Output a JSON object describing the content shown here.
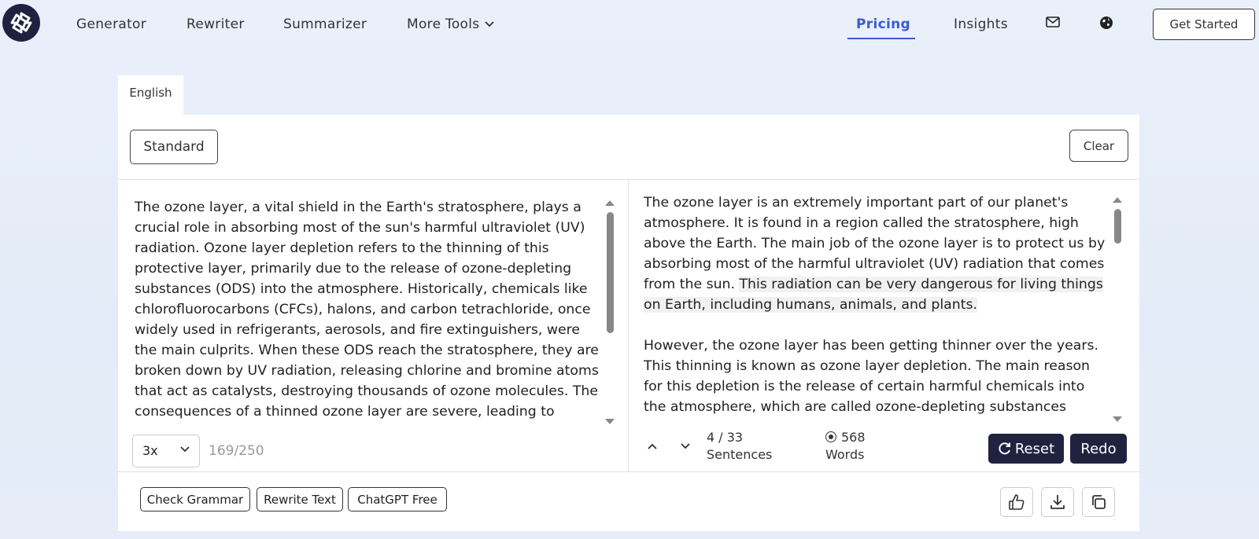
{
  "nav": {
    "links": [
      {
        "label": "Generator"
      },
      {
        "label": "Rewriter"
      },
      {
        "label": "Summarizer"
      },
      {
        "label": "More Tools"
      }
    ],
    "pricing": "Pricing",
    "insights": "Insights",
    "mail_icon": "mail-icon",
    "globe_icon": "globe-icon",
    "get_started": "Get Started",
    "accent_color": "#3b5bd6"
  },
  "editor": {
    "language_tab": "English",
    "mode": "Standard",
    "clear": "Clear",
    "input_text": "The ozone layer, a vital shield in the Earth's stratosphere, plays a crucial role in absorbing most of the sun's harmful ultraviolet (UV) radiation. Ozone layer depletion refers to the thinning of this protective layer, primarily due to the release of ozone-depleting substances (ODS) into the atmosphere. Historically, chemicals like chlorofluorocarbons (CFCs), halons, and carbon tetrachloride, once widely used in refrigerants, aerosols, and fire extinguishers, were the main culprits. When these ODS reach the stratosphere, they are broken down by UV radiation, releasing chlorine and bromine atoms that act as catalysts, destroying thousands of ozone molecules. The consequences of a thinned ozone layer are severe, leading to increased UV radiation reaching the Earth's",
    "output_para1_plain": "The ozone layer is an extremely important part of our planet's atmosphere. It is found in a region called the stratosphere, high above the Earth. The main job of the ozone layer is to protect us by absorbing most of the harmful ultraviolet (UV) radiation that comes from the sun. ",
    "output_para1_highlight": "This radiation can be very dangerous for living things on Earth, including humans, animals, and plants.",
    "output_para2": "However, the ozone layer has been getting thinner over the years. This thinning is known as ozone layer depletion. The main reason for this depletion is the release of certain harmful chemicals into the atmosphere, which are called ozone-depleting substances (ODS). These substances, such as halons, then remain in the upper",
    "strength": "3x",
    "word_count_limit": "169/250",
    "sentence_position": "4 / 33",
    "sentence_label": "Sentences",
    "word_count": "568",
    "word_label": "Words",
    "reset": "Reset",
    "redo": "Redo",
    "tools": [
      "Check Grammar",
      "Rewrite Text",
      "ChatGPT Free"
    ],
    "action_icons": [
      "thumbs-up-icon",
      "download-icon",
      "copy-icon"
    ],
    "dark_button_color": "#1f2340"
  }
}
